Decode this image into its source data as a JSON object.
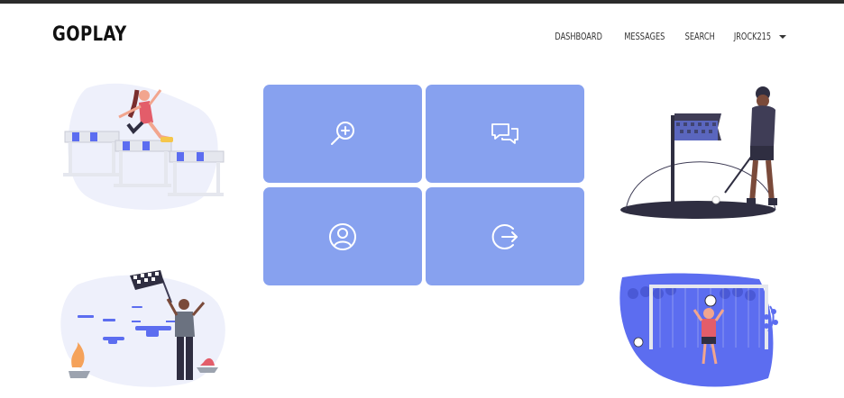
{
  "header": {
    "brand": "GOPLAY",
    "nav": {
      "dashboard": "DASHBOARD",
      "messages": "MESSAGES",
      "search": "SEARCH",
      "user": "JROCK215"
    }
  },
  "tiles": [
    {
      "icon": "search-plus-icon"
    },
    {
      "icon": "chat-bubbles-icon"
    },
    {
      "icon": "user-circle-icon"
    },
    {
      "icon": "logout-icon"
    }
  ],
  "illustrations": [
    {
      "icon": "hurdles-runner-illustration"
    },
    {
      "icon": "golfer-illustration"
    },
    {
      "icon": "drone-race-illustration"
    },
    {
      "icon": "soccer-goalkeeper-illustration"
    }
  ],
  "colors": {
    "tile": "#87a1ef",
    "accent": "#5c6df0",
    "dark": "#2f2e41",
    "text": "#111111"
  }
}
